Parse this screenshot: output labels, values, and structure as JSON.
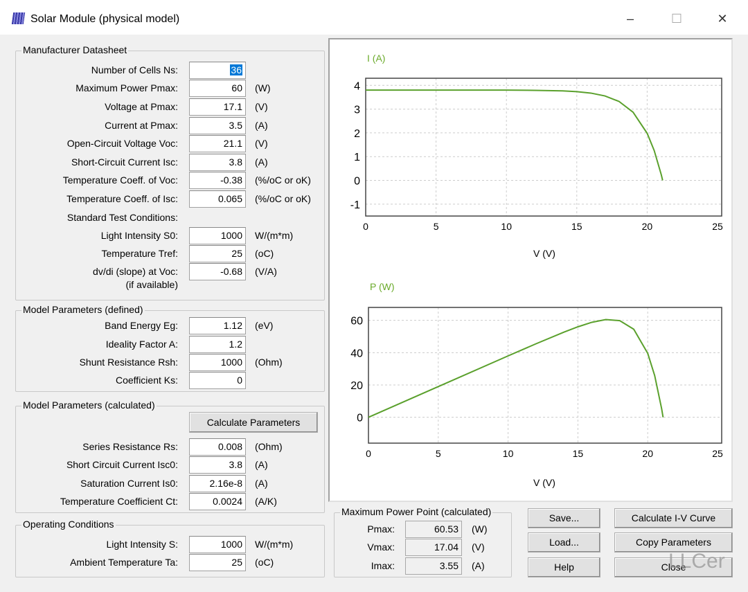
{
  "window": {
    "title": "Solar Module (physical model)",
    "minimize": "–",
    "maximize": "☐",
    "close": "✕"
  },
  "datasheet": {
    "title": "Manufacturer Datasheet",
    "rows": [
      {
        "label": "Number of Cells Ns:",
        "value": "36",
        "unit": ""
      },
      {
        "label": "Maximum Power Pmax:",
        "value": "60",
        "unit": "(W)"
      },
      {
        "label": "Voltage at Pmax:",
        "value": "17.1",
        "unit": "(V)"
      },
      {
        "label": "Current at Pmax:",
        "value": "3.5",
        "unit": "(A)"
      },
      {
        "label": "Open-Circuit Voltage Voc:",
        "value": "21.1",
        "unit": "(V)"
      },
      {
        "label": "Short-Circuit Current Isc:",
        "value": "3.8",
        "unit": "(A)"
      },
      {
        "label": "Temperature Coeff. of Voc:",
        "value": "-0.38",
        "unit": "(%/oC or oK)"
      },
      {
        "label": "Temperature Coeff. of Isc:",
        "value": "0.065",
        "unit": "(%/oC or oK)"
      },
      {
        "label": "Light Intensity S0:",
        "value": "1000",
        "unit": "W/(m*m)"
      },
      {
        "label": "Temperature Tref:",
        "value": "25",
        "unit": "(oC)"
      },
      {
        "label": "dv/di (slope) at Voc:",
        "value": "-0.68",
        "unit": "(V/A)"
      }
    ],
    "stc_label": "Standard Test Conditions:",
    "slope_note": "(if available)"
  },
  "defined": {
    "title": "Model Parameters (defined)",
    "rows": [
      {
        "label": "Band Energy Eg:",
        "value": "1.12",
        "unit": "(eV)"
      },
      {
        "label": "Ideality Factor A:",
        "value": "1.2",
        "unit": ""
      },
      {
        "label": "Shunt Resistance Rsh:",
        "value": "1000",
        "unit": "(Ohm)"
      },
      {
        "label": "Coefficient Ks:",
        "value": "0",
        "unit": ""
      }
    ]
  },
  "calculated": {
    "title": "Model Parameters (calculated)",
    "button": "Calculate Parameters",
    "rows": [
      {
        "label": "Series Resistance Rs:",
        "value": "0.008",
        "unit": "(Ohm)"
      },
      {
        "label": "Short Circuit Current Isc0:",
        "value": "3.8",
        "unit": "(A)"
      },
      {
        "label": "Saturation Current Is0:",
        "value": "2.16e-8",
        "unit": "(A)"
      },
      {
        "label": "Temperature Coefficient Ct:",
        "value": "0.0024",
        "unit": "(A/K)"
      }
    ]
  },
  "operating": {
    "title": "Operating Conditions",
    "rows": [
      {
        "label": "Light Intensity S:",
        "value": "1000",
        "unit": "W/(m*m)"
      },
      {
        "label": "Ambient Temperature Ta:",
        "value": "25",
        "unit": "(oC)"
      }
    ]
  },
  "mpp": {
    "title": "Maximum Power Point (calculated)",
    "rows": [
      {
        "label": "Pmax:",
        "value": "60.53",
        "unit": "(W)"
      },
      {
        "label": "Vmax:",
        "value": "17.04",
        "unit": "(V)"
      },
      {
        "label": "Imax:",
        "value": "3.55",
        "unit": "(A)"
      }
    ]
  },
  "buttons": {
    "save": "Save...",
    "load": "Load...",
    "help": "Help",
    "calc_iv": "Calculate I-V Curve",
    "copy": "Copy Parameters",
    "close": "Close"
  },
  "watermark": "LLCer",
  "colors": {
    "curve": "#5aa02c",
    "axis_title": "#6aaa2a"
  },
  "chart_data": [
    {
      "type": "line",
      "ylabel": "I (A)",
      "xlabel": "V (V)",
      "xlim": [
        0,
        25
      ],
      "ylim": [
        -1.5,
        4.3
      ],
      "xticks": [
        0,
        5,
        10,
        15,
        20,
        25
      ],
      "yticks": [
        -1,
        0,
        1,
        2,
        3,
        4
      ],
      "grid": true,
      "x": [
        0,
        5,
        10,
        12,
        14,
        15,
        16,
        17,
        18,
        19,
        20,
        20.5,
        21,
        21.1
      ],
      "y": [
        3.8,
        3.8,
        3.8,
        3.79,
        3.767,
        3.736,
        3.675,
        3.556,
        3.324,
        2.87,
        1.982,
        1.257,
        0.246,
        0
      ]
    },
    {
      "type": "line",
      "ylabel": "P (W)",
      "xlabel": "V (V)",
      "xlim": [
        0,
        25
      ],
      "ylim": [
        -16,
        68
      ],
      "xticks": [
        0,
        5,
        10,
        15,
        20,
        25
      ],
      "yticks": [
        0,
        20,
        40,
        60
      ],
      "grid": true,
      "x": [
        0,
        5,
        10,
        12,
        14,
        15,
        16,
        17,
        18,
        19,
        20,
        20.5,
        21,
        21.1
      ],
      "y": [
        0,
        19,
        38,
        45.5,
        52.7,
        56.0,
        58.8,
        60.5,
        59.8,
        54.5,
        39.6,
        25.8,
        5.2,
        0
      ]
    }
  ]
}
